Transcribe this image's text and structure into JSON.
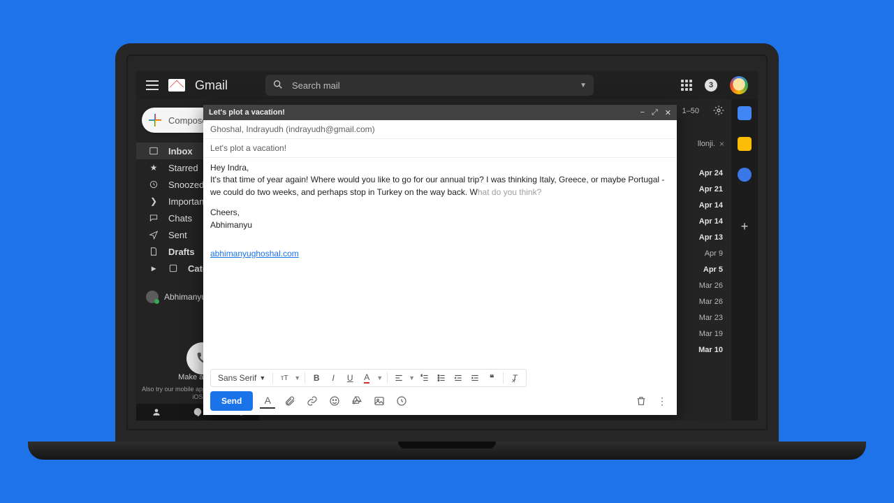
{
  "brand": "Gmail",
  "search": {
    "placeholder": "Search mail"
  },
  "badge_count": "3",
  "compose_label": "Compose",
  "nav": {
    "inbox": "Inbox",
    "starred": "Starred",
    "snoozed": "Snoozed",
    "important": "Important",
    "chats": "Chats",
    "sent": "Sent",
    "drafts": "Drafts",
    "categories": "Categories"
  },
  "chat_user": "Abhimanyu",
  "make_call": "Make a call",
  "mobile_note": "Also try our mobile apps for Android and iOS",
  "toolbar": {
    "page": "1–50"
  },
  "peek": {
    "sender": "llonji.",
    "close": "×"
  },
  "dates": [
    {
      "t": "Apr 24",
      "b": true
    },
    {
      "t": "Apr 21",
      "b": true
    },
    {
      "t": "Apr 14",
      "b": true
    },
    {
      "t": "Apr 14",
      "b": true
    },
    {
      "t": "Apr 13",
      "b": true
    },
    {
      "t": "Apr 9",
      "b": false
    },
    {
      "t": "Apr 5",
      "b": true
    },
    {
      "t": "Mar 26",
      "b": false
    },
    {
      "t": "Mar 26",
      "b": false
    },
    {
      "t": "Mar 23",
      "b": false
    },
    {
      "t": "Mar 19",
      "b": false
    },
    {
      "t": "Mar 10",
      "b": true
    }
  ],
  "compose": {
    "title": "Let's plot a vacation!",
    "to": "Ghoshal, Indrayudh (indrayudh@gmail.com)",
    "subject": "Let's plot a vacation!",
    "greet": "Hey Indra,",
    "p1a": "It's that time of year again! Where would you like to go for our annual trip? I was thinking Italy, Greece, or maybe Portugal - we could do two weeks, and perhaps stop in Turkey on the way back. W",
    "p1b": "hat do you think?",
    "cheers": "Cheers,",
    "sig_name": "Abhimanyu",
    "sig_link": "abhimanyughoshal.com",
    "font": "Sans Serif",
    "send": "Send"
  }
}
